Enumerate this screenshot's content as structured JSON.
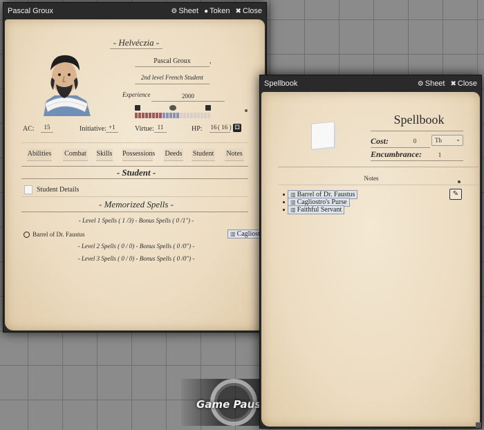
{
  "background": {
    "game_paused": "Game Paused"
  },
  "sheet_window": {
    "title": "Pascal Groux",
    "buttons": {
      "sheet": "Sheet",
      "token": "Token",
      "close": "Close"
    },
    "name_header": "- Helvéczia -",
    "character_name": "Pascal Groux",
    "name_suffix": ",",
    "level_class": "2nd level French Student",
    "experience_label": "Experience",
    "experience_value": "2000",
    "virtue_bar": {
      "value_fraction": 0.33
    },
    "stats": {
      "ac_label": "AC:",
      "ac_value": "15",
      "initiative_label": "Initiative:",
      "initiative_value": "+1",
      "virtue_label": "Virtue:",
      "virtue_value": "11",
      "hp_label": "HP:",
      "hp_value": "16",
      "hp_max": "( 16 )"
    },
    "tabs": [
      "Abilities",
      "Combat",
      "Skills",
      "Possessions",
      "Deeds",
      "Student",
      "Notes"
    ],
    "section_student": "- Student -",
    "student_details": "Student Details",
    "section_memorized": "- Memorized Spells -",
    "level1_spells": "- Level 1 Spells ( 1 /3) - Bonus Spells ( 0 /1\") -",
    "memorized_spell": "Barrel of Dr. Faustus",
    "level2_spells": "- Level 2 Spells ( 0 / 0) - Bonus Spells ( 0 /0\") -",
    "level3_spells": "- Level 3 Spells ( 0 / 0) - Bonus Spells ( 0 /0\") -",
    "drag_item": "Cagliostro's Purse"
  },
  "spellbook_window": {
    "title": "Spellbook",
    "buttons": {
      "sheet": "Sheet",
      "close": "Close"
    },
    "heading": "Spellbook",
    "cost_label": "Cost:",
    "cost_value": "0",
    "cost_unit": "Th",
    "encumbrance_label": "Encumbrance:",
    "encumbrance_value": "1",
    "notes_label": "Notes",
    "spells": [
      "Barrel of Dr. Faustus",
      "Cagliostro's Purse",
      "Faithful Servant"
    ]
  }
}
